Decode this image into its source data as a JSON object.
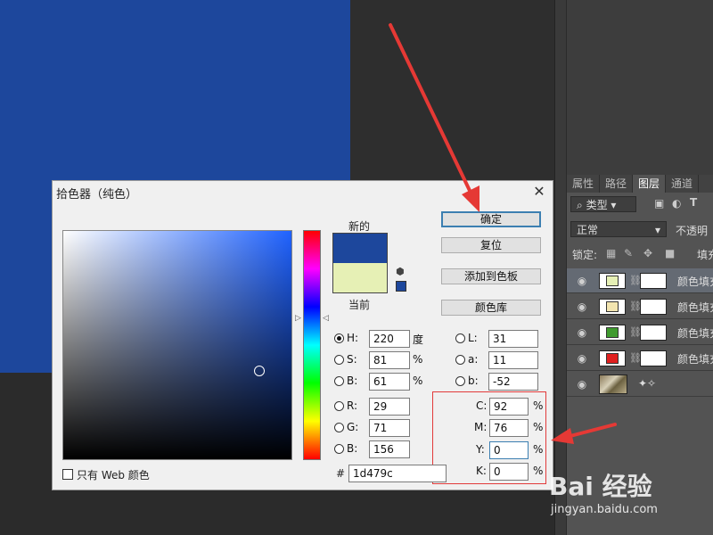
{
  "panel": {
    "tabs": [
      "属性",
      "路径",
      "图层",
      "通道"
    ],
    "active_tab": "图层",
    "filter_label": "类型",
    "blend_mode": "正常",
    "opacity_label": "不透明",
    "lock_label": "锁定:",
    "fill_label": "填充",
    "layers": [
      {
        "name": "颜色填充",
        "color": "#e6f0b5",
        "selected": true
      },
      {
        "name": "颜色填充",
        "color": "#f3e5b0",
        "selected": false
      },
      {
        "name": "颜色填充",
        "color": "#3f9a2e",
        "selected": false
      },
      {
        "name": "颜色填充",
        "color": "#e0201f",
        "selected": false
      }
    ]
  },
  "dialog": {
    "title": "拾色器（纯色）",
    "new_label": "新的",
    "current_label": "当前",
    "new_color": "#1d479c",
    "current_color": "#e6f0b5",
    "buttons": {
      "ok": "确定",
      "reset": "复位",
      "add_swatch": "添加到色板",
      "color_library": "颜色库"
    },
    "hsb": {
      "h_label": "H:",
      "h": "220",
      "h_unit": "度",
      "s_label": "S:",
      "s": "81",
      "s_unit": "%",
      "b_label": "B:",
      "b": "61",
      "b_unit": "%"
    },
    "rgb": {
      "r_label": "R:",
      "r": "29",
      "g_label": "G:",
      "g": "71",
      "b_label": "B:",
      "b": "156"
    },
    "lab": {
      "l_label": "L:",
      "l": "31",
      "a_label": "a:",
      "a": "11",
      "b_label": "b:",
      "b": "-52"
    },
    "cmyk": {
      "c_label": "C:",
      "c": "92",
      "m_label": "M:",
      "m": "76",
      "y_label": "Y:",
      "y": "0",
      "k_label": "K:",
      "k": "0",
      "unit": "%"
    },
    "web_only_label": "只有 Web 颜色",
    "hex_label": "#",
    "hex": "1d479c"
  },
  "watermark": {
    "text": "Bai 经验",
    "url_text": "jingyan.baidu.com"
  }
}
